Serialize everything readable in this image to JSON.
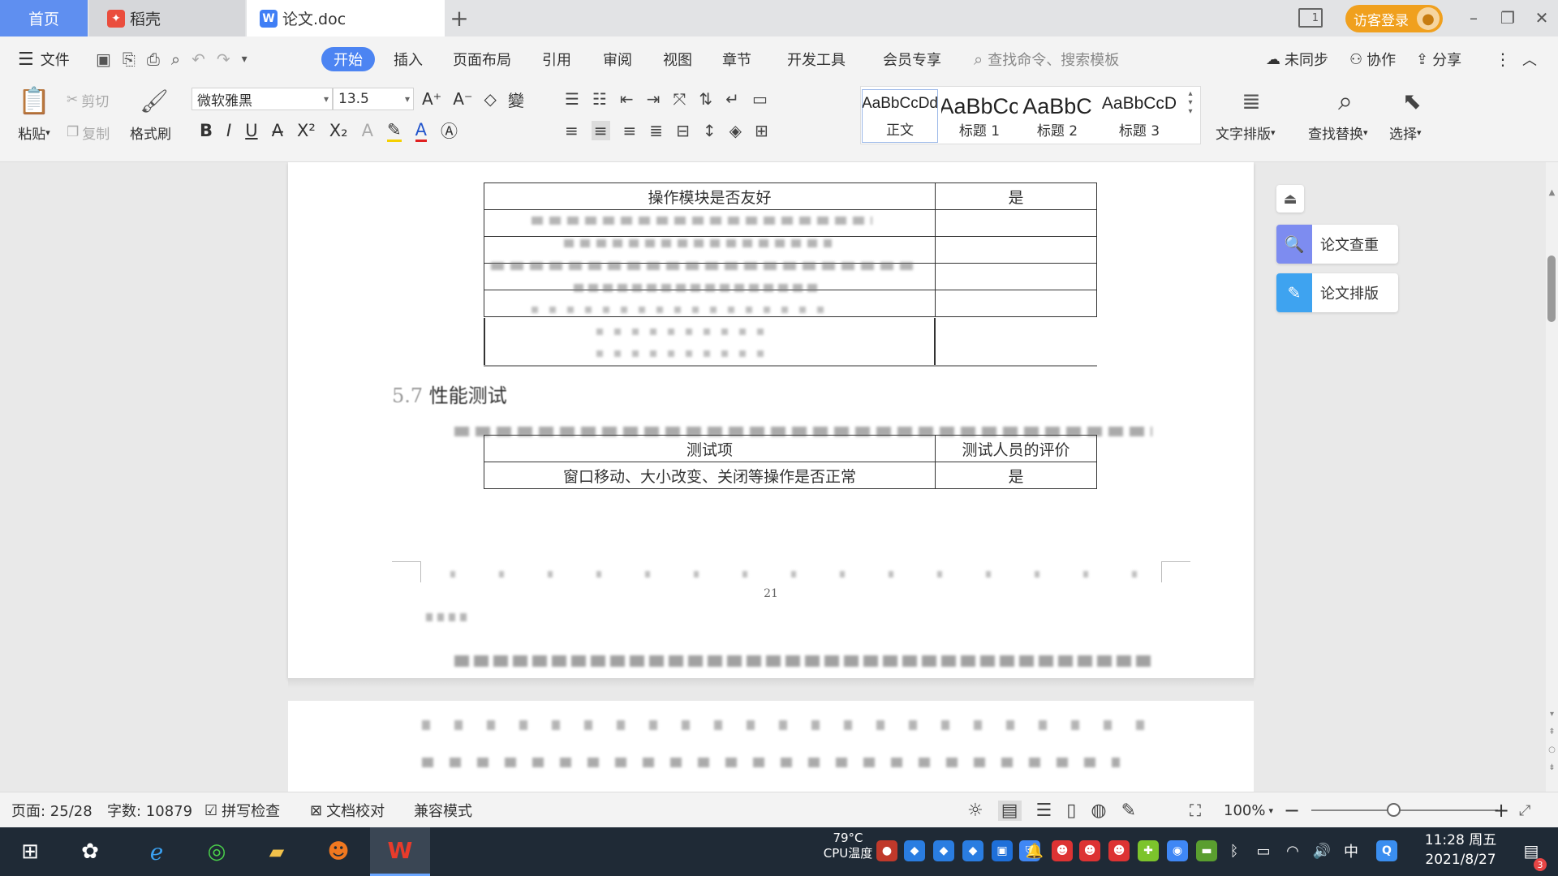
{
  "tabs": {
    "home": "首页",
    "daoke": "稻壳",
    "doc": "论文.doc",
    "plus": "+",
    "login": "访客登录"
  },
  "window": {
    "min": "–",
    "restore": "❐",
    "close": "✕",
    "layout_icon": "1"
  },
  "menu": {
    "file": "文件",
    "start": "开始",
    "insert": "插入",
    "layout": "页面布局",
    "ref": "引用",
    "review": "审阅",
    "view": "视图",
    "chapter": "章节",
    "dev": "开发工具",
    "member": "会员专享",
    "search": "查找命令、搜索模板",
    "sync": "未同步",
    "collab": "协作",
    "share": "分享"
  },
  "ribbon": {
    "paste": "粘贴",
    "cut": "剪切",
    "copy": "复制",
    "format_painter": "格式刷",
    "font": "微软雅黑",
    "size": "13.5",
    "styles": [
      {
        "sample": "AaBbCcDd",
        "name": "正文"
      },
      {
        "sample": "AaBbCc",
        "name": "标题 1"
      },
      {
        "sample": "AaBbC",
        "name": "标题 2"
      },
      {
        "sample": "AaBbCcD",
        "name": "标题 3"
      }
    ],
    "text_layout": "文字排版",
    "find_replace": "查找替换",
    "select": "选择"
  },
  "document": {
    "table1_rows": [
      {
        "item": "操作模块是否友好",
        "eval": "是"
      },
      {
        "item": "",
        "eval": ""
      },
      {
        "item": "",
        "eval": ""
      },
      {
        "item": "",
        "eval": ""
      },
      {
        "item": "",
        "eval": ""
      }
    ],
    "section_title": "性能测试",
    "table2_header": {
      "item": "测试项",
      "eval": "测试人员的评价"
    },
    "table2_rows": [
      {
        "item": "窗口移动、大小改变、关闭等操作是否正常",
        "eval": "是"
      }
    ],
    "page_number": "21"
  },
  "side_panel": {
    "check": "论文查重",
    "format": "论文排版"
  },
  "status": {
    "page": "页面: 25/28",
    "words": "字数: 10879",
    "spell": "拼写检查",
    "proof": "文档校对",
    "compat": "兼容模式",
    "zoom": "100%"
  },
  "taskbar": {
    "cpu_temp": "79°C",
    "cpu_label": "CPU温度",
    "ime": "中",
    "time": "11:28 周五",
    "date": "2021/8/27",
    "notif_count": "3"
  },
  "colors": {
    "accent": "#4c84f2",
    "login": "#f0a01e",
    "taskbar": "#1f2a36"
  }
}
